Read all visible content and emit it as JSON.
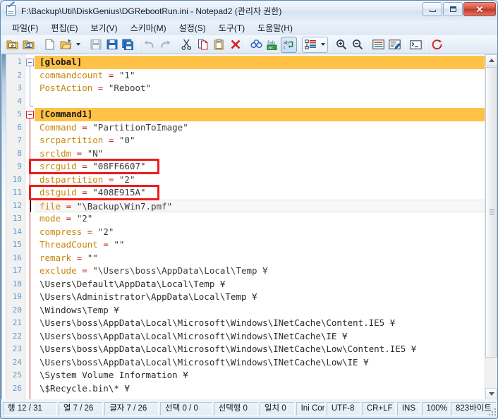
{
  "window": {
    "title": "F:\\Backup\\Util\\DiskGenius\\DGRebootRun.ini - Notepad2 (관리자 권한)",
    "app_icon": "notepad-document-icon",
    "controls": {
      "minimize": "minimize-icon",
      "maximize": "maximize-icon",
      "close": "✕"
    }
  },
  "menubar": {
    "items": [
      {
        "label": "파일(F)",
        "name": "menu-file"
      },
      {
        "label": "편집(E)",
        "name": "menu-edit"
      },
      {
        "label": "보기(V)",
        "name": "menu-view"
      },
      {
        "label": "스키마(M)",
        "name": "menu-schema"
      },
      {
        "label": "설정(S)",
        "name": "menu-settings"
      },
      {
        "label": "도구(T)",
        "name": "menu-tools"
      },
      {
        "label": "도움말(H)",
        "name": "menu-help"
      }
    ]
  },
  "toolbar": {
    "buttons": [
      "favorites-folder-icon",
      "browse-folder-icon",
      "new-file-icon",
      "open-file-icon",
      "open-dropdown-arrow",
      "save-icon",
      "save-as-icon",
      "save-copy-icon",
      "undo-icon",
      "redo-icon",
      "cut-icon",
      "copy-icon",
      "paste-icon",
      "delete-icon",
      "find-icon",
      "replace-icon",
      "find-replace-toggle-icon",
      "schemes-icon",
      "schemes-dropdown-arrow",
      "zoom-in-icon",
      "zoom-out-icon",
      "word-wrap-icon",
      "edit-properties-icon",
      "console-icon",
      "exit-icon"
    ]
  },
  "editor": {
    "current_line": 12,
    "lines": [
      {
        "n": 1,
        "type": "section",
        "text": "[global]"
      },
      {
        "n": 2,
        "type": "kv",
        "key": "commandcount",
        "value": "\"1\""
      },
      {
        "n": 3,
        "type": "kv",
        "key": "PostAction",
        "value": "\"Reboot\""
      },
      {
        "n": 4,
        "type": "blank",
        "text": ""
      },
      {
        "n": 5,
        "type": "section",
        "text": "[Command1]"
      },
      {
        "n": 6,
        "type": "kv",
        "key": "Command",
        "value": "\"PartitionToImage\""
      },
      {
        "n": 7,
        "type": "kv",
        "key": "srcpartition",
        "value": "\"0\""
      },
      {
        "n": 8,
        "type": "kv",
        "key": "srcldm",
        "value": "\"N\""
      },
      {
        "n": 9,
        "type": "kv",
        "key": "srcguid",
        "value": "\"08FF6607\""
      },
      {
        "n": 10,
        "type": "kv",
        "key": "dstpartition",
        "value": "\"2\""
      },
      {
        "n": 11,
        "type": "kv",
        "key": "dstguid",
        "value": "\"408E915A\""
      },
      {
        "n": 12,
        "type": "kv",
        "key": "file",
        "value": "\"\\Backup\\Win7.pmf\""
      },
      {
        "n": 13,
        "type": "kv",
        "key": "mode",
        "value": "\"2\""
      },
      {
        "n": 14,
        "type": "kv",
        "key": "compress",
        "value": "\"2\""
      },
      {
        "n": 15,
        "type": "kv",
        "key": "ThreadCount",
        "value": "\"\""
      },
      {
        "n": 16,
        "type": "kv",
        "key": "remark",
        "value": "\"\""
      },
      {
        "n": 17,
        "type": "kv",
        "key": "exclude",
        "value": "\"\\Users\\boss\\AppData\\Local\\Temp ¥"
      },
      {
        "n": 18,
        "type": "plain",
        "text": "\\Users\\Default\\AppData\\Local\\Temp ¥"
      },
      {
        "n": 19,
        "type": "plain",
        "text": "\\Users\\Administrator\\AppData\\Local\\Temp ¥"
      },
      {
        "n": 20,
        "type": "plain",
        "text": "\\Windows\\Temp ¥"
      },
      {
        "n": 21,
        "type": "plain",
        "text": "\\Users\\boss\\AppData\\Local\\Microsoft\\Windows\\INetCache\\Content.IE5 ¥"
      },
      {
        "n": 22,
        "type": "plain",
        "text": "\\Users\\boss\\AppData\\Local\\Microsoft\\Windows\\INetCache\\IE ¥"
      },
      {
        "n": 23,
        "type": "plain",
        "text": "\\Users\\boss\\AppData\\Local\\Microsoft\\Windows\\INetCache\\Low\\Content.IE5 ¥"
      },
      {
        "n": 24,
        "type": "plain",
        "text": "\\Users\\boss\\AppData\\Local\\Microsoft\\Windows\\INetCache\\Low\\IE ¥"
      },
      {
        "n": 25,
        "type": "plain",
        "text": "\\System Volume Information ¥"
      },
      {
        "n": 26,
        "type": "plain",
        "text": "\\$Recycle.bin\\* ¥"
      }
    ],
    "annotations": [
      {
        "name": "annotation-box-srcguid",
        "line": 9,
        "color": "#ee1c1c"
      },
      {
        "name": "annotation-box-dstguid",
        "line": 11,
        "color": "#ee1c1c"
      }
    ],
    "colors": {
      "section_background": "#ffc247",
      "key": "#c8860a",
      "equals": "#cc2222",
      "value": "#3b3b3b",
      "line_number": "#5c9ad2",
      "current_line_background": "#f7f7f7"
    }
  },
  "statusbar": {
    "cells": [
      {
        "name": "status-row",
        "text": "행 12 / 31"
      },
      {
        "name": "status-column",
        "text": "열 7 / 26"
      },
      {
        "name": "status-char",
        "text": "글자 7 / 26"
      },
      {
        "name": "status-selection",
        "text": "선택 0 / 0"
      },
      {
        "name": "status-sel-lines",
        "text": "선택행 0"
      },
      {
        "name": "status-matches",
        "text": "일치 0"
      },
      {
        "name": "status-scheme",
        "text": "Ini Config Files"
      },
      {
        "name": "status-encoding",
        "text": "UTF-8"
      },
      {
        "name": "status-eol",
        "text": "CR+LF"
      },
      {
        "name": "status-insert-mode",
        "text": "INS"
      },
      {
        "name": "status-zoom",
        "text": "100%"
      },
      {
        "name": "status-filesize",
        "text": "823바이트"
      }
    ]
  }
}
